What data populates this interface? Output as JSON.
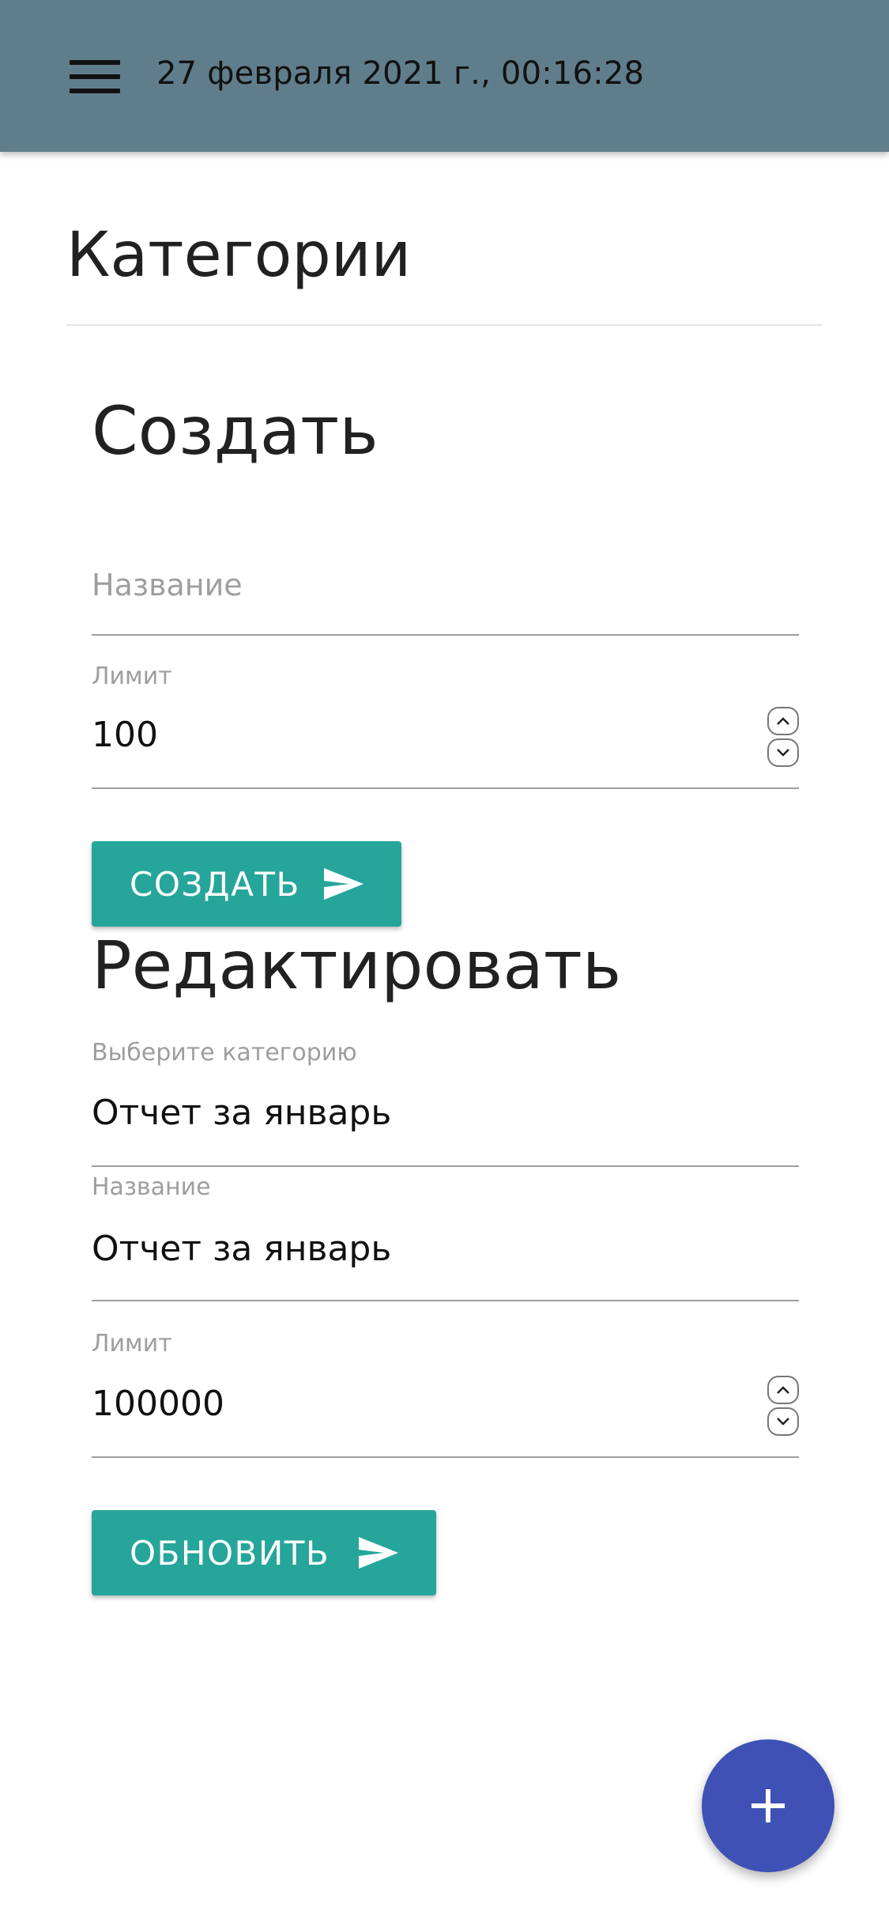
{
  "header": {
    "datetime": "27 февраля 2021 г., 00:16:28",
    "menu_icon": "hamburger-menu-icon"
  },
  "page": {
    "title": "Категории"
  },
  "create": {
    "title": "Создать",
    "name_placeholder": "Название",
    "limit_label": "Лимит",
    "limit_value": "100",
    "button_label": "СОЗДАТЬ",
    "button_icon": "send-icon"
  },
  "edit": {
    "title": "Редактировать",
    "category_label": "Выберите категорию",
    "category_value": "Отчет за январь",
    "name_label": "Название",
    "name_value": "Отчет за январь",
    "limit_label": "Лимит",
    "limit_value": "100000",
    "button_label": "ОБНОВИТЬ",
    "button_icon": "send-icon"
  },
  "fab": {
    "icon": "plus-icon"
  },
  "colors": {
    "header_bg": "#607d8b",
    "button_bg": "#26a69a",
    "fab_bg": "#3f51b5"
  }
}
